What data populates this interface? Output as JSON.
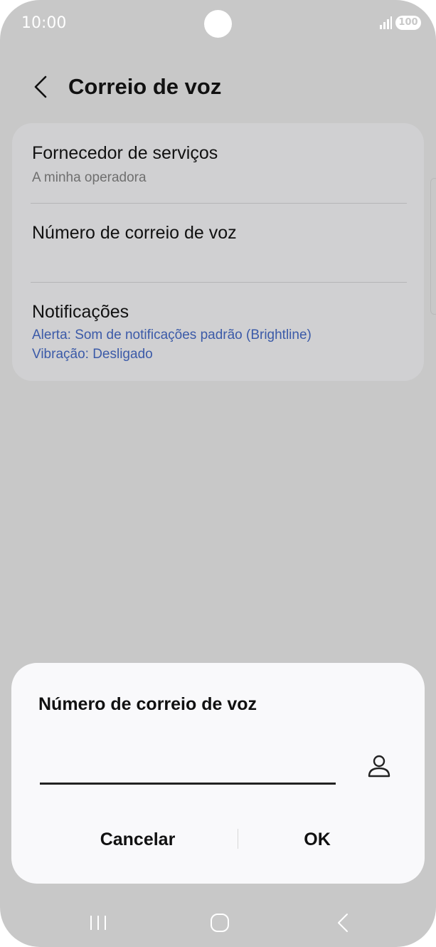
{
  "status_bar": {
    "time": "10:00",
    "battery": "100",
    "signal_icon": "signal-icon"
  },
  "header": {
    "title": "Correio de voz",
    "back_icon": "chevron-left-icon"
  },
  "settings": {
    "items": [
      {
        "title": "Fornecedor de serviços",
        "subtitle": "A minha operadora"
      },
      {
        "title": "Número de correio de voz"
      },
      {
        "title": "Notificações",
        "alert": "Alerta: Som de notificações padrão (Brightline)",
        "vibration": "Vibração: Desligado"
      }
    ]
  },
  "dialog": {
    "title": "Número de correio de voz",
    "input_value": "",
    "contact_icon": "contact-person-icon",
    "cancel_label": "Cancelar",
    "ok_label": "OK"
  },
  "nav_bar": {
    "icons": [
      "recent-apps-icon",
      "home-icon",
      "back-icon"
    ]
  },
  "colors": {
    "scrim_background": "#c8c8c8",
    "card": "#d0d0d2",
    "dialog": "#f9f9fb",
    "link_blue": "#3b5aa8"
  }
}
